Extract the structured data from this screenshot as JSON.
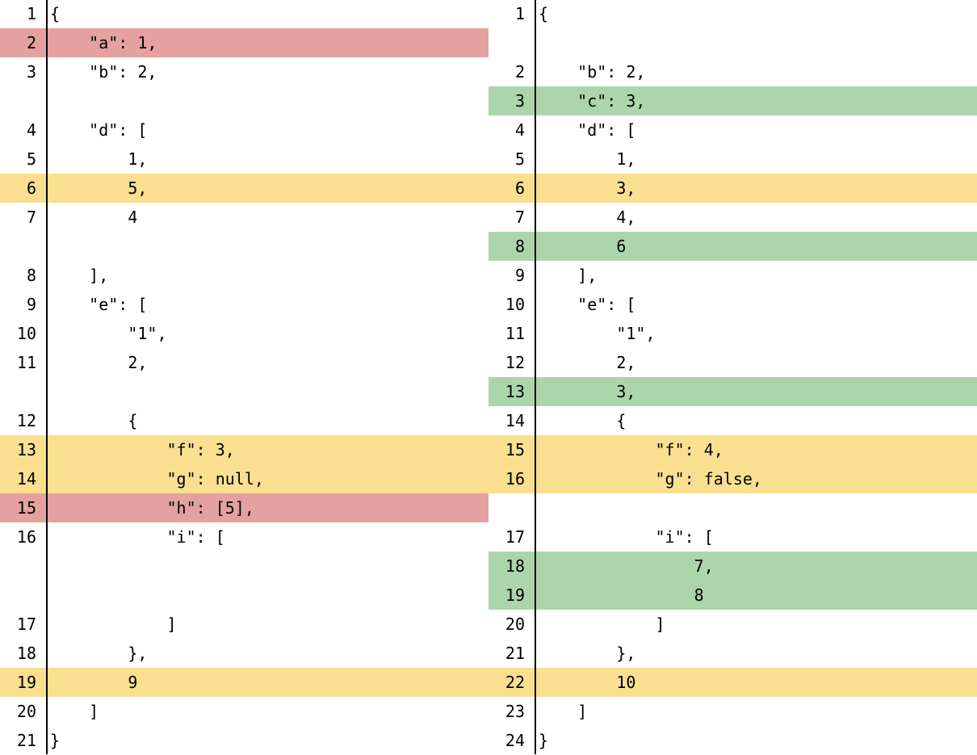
{
  "colors": {
    "removed": "#e4a19f",
    "added": "#add5ab",
    "changed": "#f9df8f",
    "gutter_line": "#000000"
  },
  "left": {
    "rows": [
      {
        "num": "1",
        "text": "{",
        "status": ""
      },
      {
        "num": "2",
        "text": "    \"a\": 1,",
        "status": "removed"
      },
      {
        "num": "3",
        "text": "    \"b\": 2,",
        "status": ""
      },
      {
        "num": "",
        "text": "",
        "status": ""
      },
      {
        "num": "4",
        "text": "    \"d\": [",
        "status": ""
      },
      {
        "num": "5",
        "text": "        1,",
        "status": ""
      },
      {
        "num": "6",
        "text": "        5,",
        "status": "changed"
      },
      {
        "num": "7",
        "text": "        4",
        "status": ""
      },
      {
        "num": "",
        "text": "",
        "status": ""
      },
      {
        "num": "8",
        "text": "    ],",
        "status": ""
      },
      {
        "num": "9",
        "text": "    \"e\": [",
        "status": ""
      },
      {
        "num": "10",
        "text": "        \"1\",",
        "status": ""
      },
      {
        "num": "11",
        "text": "        2,",
        "status": ""
      },
      {
        "num": "",
        "text": "",
        "status": ""
      },
      {
        "num": "12",
        "text": "        {",
        "status": ""
      },
      {
        "num": "13",
        "text": "            \"f\": 3,",
        "status": "changed"
      },
      {
        "num": "14",
        "text": "            \"g\": null,",
        "status": "changed"
      },
      {
        "num": "15",
        "text": "            \"h\": [5],",
        "status": "removed"
      },
      {
        "num": "16",
        "text": "            \"i\": [",
        "status": ""
      },
      {
        "num": "",
        "text": "",
        "status": ""
      },
      {
        "num": "",
        "text": "",
        "status": ""
      },
      {
        "num": "17",
        "text": "            ]",
        "status": ""
      },
      {
        "num": "18",
        "text": "        },",
        "status": ""
      },
      {
        "num": "19",
        "text": "        9",
        "status": "changed"
      },
      {
        "num": "20",
        "text": "    ]",
        "status": ""
      },
      {
        "num": "21",
        "text": "}",
        "status": ""
      }
    ]
  },
  "right": {
    "rows": [
      {
        "num": "1",
        "text": "{",
        "status": ""
      },
      {
        "num": "",
        "text": "",
        "status": ""
      },
      {
        "num": "2",
        "text": "    \"b\": 2,",
        "status": ""
      },
      {
        "num": "3",
        "text": "    \"c\": 3,",
        "status": "added"
      },
      {
        "num": "4",
        "text": "    \"d\": [",
        "status": ""
      },
      {
        "num": "5",
        "text": "        1,",
        "status": ""
      },
      {
        "num": "6",
        "text": "        3,",
        "status": "changed"
      },
      {
        "num": "7",
        "text": "        4,",
        "status": ""
      },
      {
        "num": "8",
        "text": "        6",
        "status": "added"
      },
      {
        "num": "9",
        "text": "    ],",
        "status": ""
      },
      {
        "num": "10",
        "text": "    \"e\": [",
        "status": ""
      },
      {
        "num": "11",
        "text": "        \"1\",",
        "status": ""
      },
      {
        "num": "12",
        "text": "        2,",
        "status": ""
      },
      {
        "num": "13",
        "text": "        3,",
        "status": "added"
      },
      {
        "num": "14",
        "text": "        {",
        "status": ""
      },
      {
        "num": "15",
        "text": "            \"f\": 4,",
        "status": "changed"
      },
      {
        "num": "16",
        "text": "            \"g\": false,",
        "status": "changed"
      },
      {
        "num": "",
        "text": "",
        "status": ""
      },
      {
        "num": "17",
        "text": "            \"i\": [",
        "status": ""
      },
      {
        "num": "18",
        "text": "                7,",
        "status": "added"
      },
      {
        "num": "19",
        "text": "                8",
        "status": "added"
      },
      {
        "num": "20",
        "text": "            ]",
        "status": ""
      },
      {
        "num": "21",
        "text": "        },",
        "status": ""
      },
      {
        "num": "22",
        "text": "        10",
        "status": "changed"
      },
      {
        "num": "23",
        "text": "    ]",
        "status": ""
      },
      {
        "num": "24",
        "text": "}",
        "status": ""
      }
    ]
  }
}
